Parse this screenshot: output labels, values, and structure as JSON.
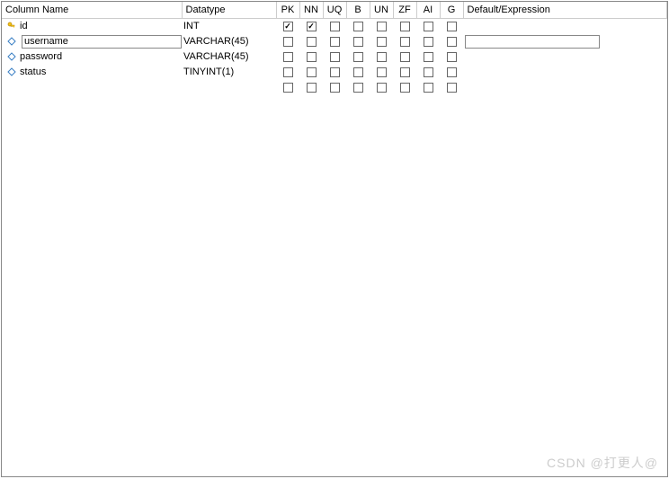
{
  "headers": {
    "name": "Column Name",
    "datatype": "Datatype",
    "pk": "PK",
    "nn": "NN",
    "uq": "UQ",
    "b": "B",
    "un": "UN",
    "zf": "ZF",
    "ai": "AI",
    "g": "G",
    "default": "Default/Expression"
  },
  "columns": [
    {
      "name": "id",
      "datatype": "INT",
      "icon": "key",
      "selected": false,
      "flags": {
        "pk": true,
        "nn": true,
        "uq": false,
        "b": false,
        "un": false,
        "zf": false,
        "ai": false,
        "g": false
      },
      "default": ""
    },
    {
      "name": "username",
      "datatype": "VARCHAR(45)",
      "icon": "diamond",
      "selected": true,
      "flags": {
        "pk": false,
        "nn": false,
        "uq": false,
        "b": false,
        "un": false,
        "zf": false,
        "ai": false,
        "g": false
      },
      "default": ""
    },
    {
      "name": "password",
      "datatype": "VARCHAR(45)",
      "icon": "diamond",
      "selected": false,
      "flags": {
        "pk": false,
        "nn": false,
        "uq": false,
        "b": false,
        "un": false,
        "zf": false,
        "ai": false,
        "g": false
      },
      "default": ""
    },
    {
      "name": "status",
      "datatype": "TINYINT(1)",
      "icon": "diamond",
      "selected": false,
      "flags": {
        "pk": false,
        "nn": false,
        "uq": false,
        "b": false,
        "un": false,
        "zf": false,
        "ai": false,
        "g": false
      },
      "default": ""
    },
    {
      "name": "",
      "datatype": "",
      "icon": "",
      "selected": false,
      "flags": {
        "pk": false,
        "nn": false,
        "uq": false,
        "b": false,
        "un": false,
        "zf": false,
        "ai": false,
        "g": false
      },
      "default": ""
    }
  ],
  "watermark": "CSDN @打更人@"
}
